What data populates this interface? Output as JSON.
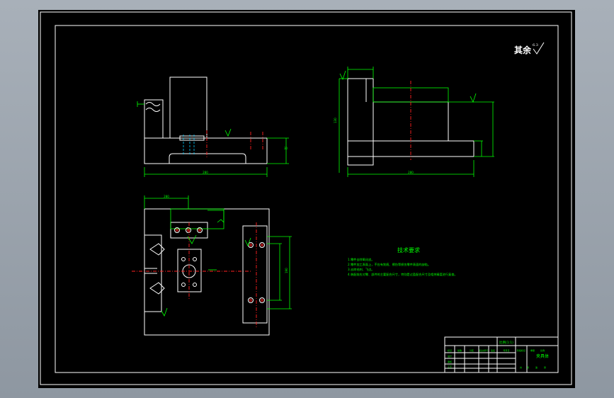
{
  "drawing": {
    "roughness_note": "其余",
    "roughness_value": "6.3",
    "tech_title": "技术要求",
    "tech_items": [
      "1.零件去除氧化皮。",
      "2.零件加工表面上，不应有划痕、擦伤等损伤零件表面的缺陷。",
      "3.去除毛刺、飞边。",
      "4.装配前应对零、部件的主要配合尺寸，特别是过盈配合尺寸及相关精度进行复查。"
    ],
    "dims": {
      "front_width": "280",
      "side_width": "280",
      "plan_width": "280",
      "plan_height": "190",
      "front_height": "30",
      "side_height": "130"
    },
    "title_block": {
      "drawing_name": "夹具体",
      "scale_label": "比例(1:1)",
      "row_labels": [
        "标记",
        "处数",
        "分区",
        "更改文件号",
        "签名",
        "年月日"
      ],
      "sign_labels": [
        "设计",
        "审核",
        "工艺"
      ],
      "stage_labels": [
        "阶段标记",
        "重量",
        "比例"
      ],
      "sheet_labels": [
        "共",
        "张",
        "第",
        "张"
      ]
    }
  },
  "colors": {
    "geometry": "#ffffff",
    "dimension": "#00ff00",
    "centerline": "#ff2020",
    "hidden": "#00ccff",
    "paper": "#000000"
  }
}
